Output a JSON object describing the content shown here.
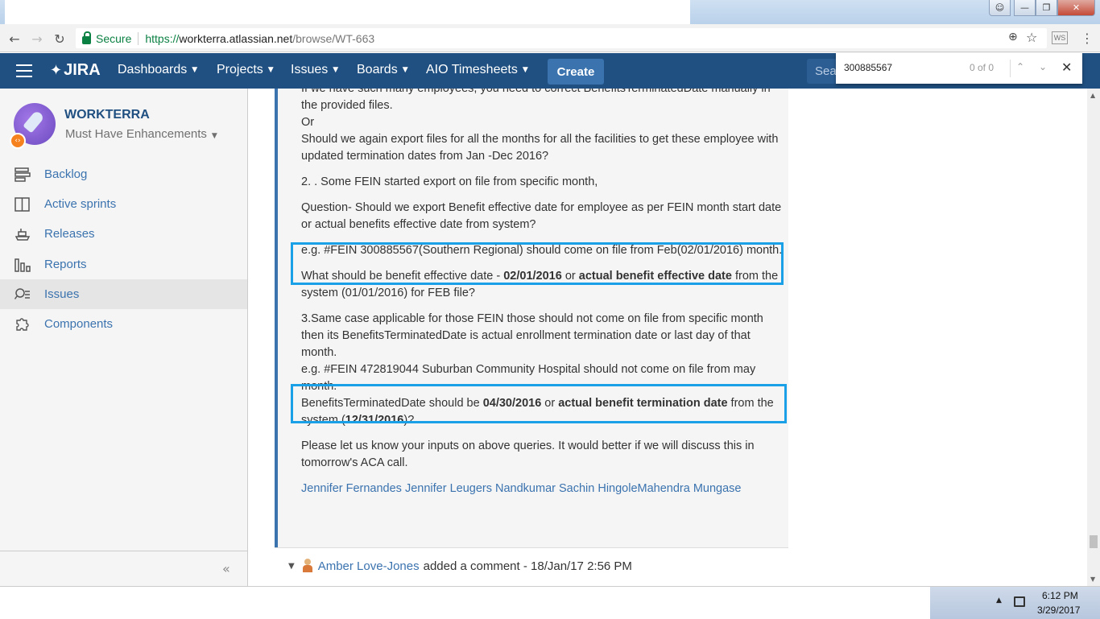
{
  "browser": {
    "secure_label": "Secure",
    "url_scheme": "https://",
    "url_host": "workterra.atlassian.net",
    "url_path": "/browse/WT-663",
    "ext_label": "WS"
  },
  "header": {
    "logo_text": "JIRA",
    "nav": {
      "dashboards": "Dashboards",
      "projects": "Projects",
      "issues": "Issues",
      "boards": "Boards",
      "aio": "AIO Timesheets"
    },
    "create_label": "Create",
    "search_placeholder": "Sea"
  },
  "findbar": {
    "query": "300885567",
    "count": "0 of 0"
  },
  "sidebar": {
    "project_name": "WORKTERRA",
    "board_name": "Must Have Enhancements",
    "items": [
      {
        "label": "Backlog"
      },
      {
        "label": "Active sprints"
      },
      {
        "label": "Releases"
      },
      {
        "label": "Reports"
      },
      {
        "label": "Issues"
      },
      {
        "label": "Components"
      }
    ],
    "collapse_glyph": "«"
  },
  "comment": {
    "p1": "If we have such many employees, you need to correct BenefitsTerminatedDate manually in the provided files.",
    "p1_or": "Or",
    "p2": "Should we again export files for all the months for all the facilities to get these employee with updated termination dates from Jan -Dec 2016?",
    "p3": "2. . Some FEIN started export on file from specific month,",
    "p4": "Question- Should we export Benefit effective date for employee as per FEIN month start date or actual benefits effective date from system?",
    "p5": "e.g. #FEIN 300885567(Southern Regional) should come on file from Feb(02/01/2016) month.",
    "p6_a": "What should be benefit effective date - ",
    "p6_b": "02/01/2016",
    "p6_c": " or ",
    "p6_d": "actual benefit effective date",
    "p6_e": " from the system (01/01/2016) for FEB file?",
    "p7": "3.Same case applicable for those FEIN those should not come on file from specific month then its BenefitsTerminatedDate is actual enrollment termination date or last day of that month.",
    "p8": "e.g. #FEIN 472819044 Suburban Community Hospital should not come on file from may month.",
    "p9_a": "BenefitsTerminatedDate should be ",
    "p9_b": "04/30/2016",
    "p9_c": " or ",
    "p9_d": "actual benefit termination date",
    "p9_e": " from the system (",
    "p9_f": "12/31/2016",
    "p9_g": ")?",
    "p10": "Please let us know your inputs on above queries. It would better if we will discuss this in tomorrow's ACA call.",
    "mentions": "Jennifer Fernandes Jennifer Leugers Nandkumar Sachin HingoleMahendra Mungase"
  },
  "next_comment": {
    "author": "Amber Love-Jones",
    "action": "added a comment - 18/Jan/17 2:56 PM"
  },
  "taskbar": {
    "time": "6:12 PM",
    "date": "3/29/2017"
  },
  "colors": {
    "header_bg": "#205081",
    "link": "#3b73af",
    "highlight_box": "#1aa0e6"
  }
}
